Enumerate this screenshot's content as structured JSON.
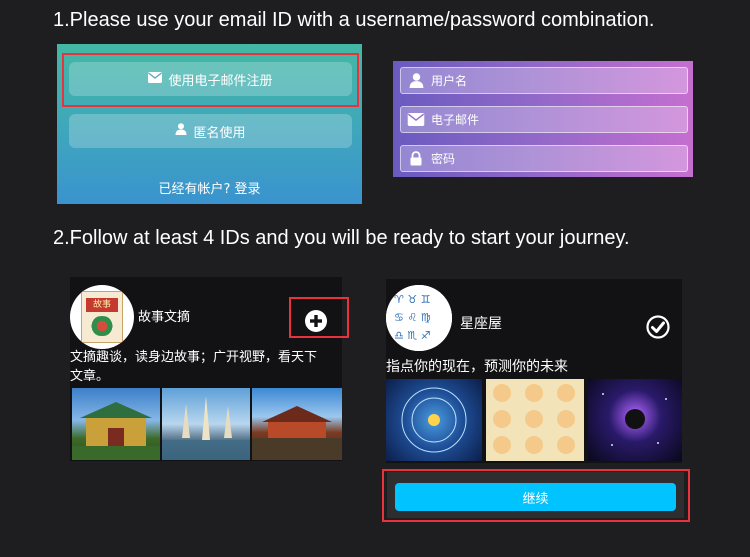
{
  "step1": {
    "text": "1.Please use your email ID with a username/password combination."
  },
  "signup": {
    "register_label": "使用电子邮件注册",
    "anonymous_label": "匿名使用",
    "login_link": "已经有帐户? 登录"
  },
  "form": {
    "username_placeholder": "用户名",
    "email_placeholder": "电子邮件",
    "password_placeholder": "密码"
  },
  "step2": {
    "text": "2.Follow at least 4 IDs and you will be ready to start your journey."
  },
  "cards": [
    {
      "name": "故事文摘",
      "avatar_text": "故事",
      "description_line1": "文摘趣谈，读身边故事；广开视野，看天下",
      "description_line2": "文章。",
      "action_icon": "plus-circle-icon",
      "followed": false
    },
    {
      "name": "星座屋",
      "description": "指点你的现在，预测你的未来",
      "action_icon": "check-circle-icon",
      "followed": true
    }
  ],
  "continue_label": "继续",
  "colors": {
    "background": "#1e1e21",
    "highlight": "#e8323c",
    "continue_button": "#00c3ff"
  }
}
